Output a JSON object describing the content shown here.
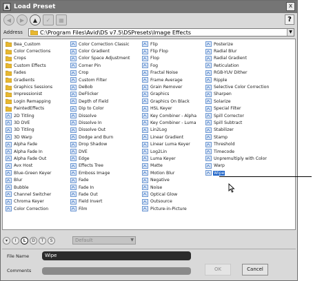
{
  "window": {
    "title": "Load Preset",
    "close_glyph": "x",
    "help_glyph": "?"
  },
  "toolbar": {
    "buttons": [
      "back-icon",
      "forward-icon",
      "up-icon",
      "checkmark-icon",
      "grid-view-icon"
    ]
  },
  "address": {
    "label": "Address",
    "path": "C:\\Program Files\\Avid\\DS  v7.5\\DSPresets\\Image Effects"
  },
  "columns": [
    [
      {
        "label": "Bea_Custom",
        "type": "folder"
      },
      {
        "label": "Color Corrections",
        "type": "folder"
      },
      {
        "label": "Crops",
        "type": "folder"
      },
      {
        "label": "Custom Effects",
        "type": "folder"
      },
      {
        "label": "Fades",
        "type": "folder"
      },
      {
        "label": "Gradients",
        "type": "folder"
      },
      {
        "label": "Graphics Sessions",
        "type": "folder"
      },
      {
        "label": "Impressionist",
        "type": "folder"
      },
      {
        "label": "Login Remapping",
        "type": "folder"
      },
      {
        "label": "PaintedEffects",
        "type": "folder"
      },
      {
        "label": "2D Titling",
        "type": "preset"
      },
      {
        "label": "3D DVE",
        "type": "preset"
      },
      {
        "label": "3D Titling",
        "type": "preset"
      },
      {
        "label": "3D Warp",
        "type": "preset"
      },
      {
        "label": "Alpha Fade",
        "type": "preset"
      },
      {
        "label": "Alpha Fade In",
        "type": "preset"
      },
      {
        "label": "Alpha Fade Out",
        "type": "preset"
      },
      {
        "label": "Avx Host",
        "type": "preset"
      },
      {
        "label": "Blue-Green Keyer",
        "type": "preset"
      },
      {
        "label": "Blur",
        "type": "preset"
      },
      {
        "label": "Bubble",
        "type": "preset"
      },
      {
        "label": "Channel Switcher",
        "type": "preset"
      },
      {
        "label": "Chroma Keyer",
        "type": "preset"
      },
      {
        "label": "Color Correction",
        "type": "preset"
      }
    ],
    [
      {
        "label": "Color Correction Classic",
        "type": "preset"
      },
      {
        "label": "Color Gradient",
        "type": "preset"
      },
      {
        "label": "Color Space Adjustment",
        "type": "preset"
      },
      {
        "label": "Corner Pin",
        "type": "preset"
      },
      {
        "label": "Crop",
        "type": "preset"
      },
      {
        "label": "Custom Filter",
        "type": "preset"
      },
      {
        "label": "DeBob",
        "type": "preset"
      },
      {
        "label": "DeFlicker",
        "type": "preset"
      },
      {
        "label": "Depth of Field",
        "type": "preset"
      },
      {
        "label": "Dip to Color",
        "type": "preset"
      },
      {
        "label": "Dissolve",
        "type": "preset"
      },
      {
        "label": "Dissolve In",
        "type": "preset"
      },
      {
        "label": "Dissolve Out",
        "type": "preset"
      },
      {
        "label": "Dodge and Burn",
        "type": "preset"
      },
      {
        "label": "Drop Shadow",
        "type": "preset"
      },
      {
        "label": "DVE",
        "type": "preset"
      },
      {
        "label": "Edge",
        "type": "preset"
      },
      {
        "label": "Effects Tree",
        "type": "preset"
      },
      {
        "label": "Emboss Image",
        "type": "preset"
      },
      {
        "label": "Fade",
        "type": "preset"
      },
      {
        "label": "Fade In",
        "type": "preset"
      },
      {
        "label": "Fade Out",
        "type": "preset"
      },
      {
        "label": "Field Invert",
        "type": "preset"
      },
      {
        "label": "Film",
        "type": "preset"
      }
    ],
    [
      {
        "label": "Flip",
        "type": "preset"
      },
      {
        "label": "Flip Flop",
        "type": "preset"
      },
      {
        "label": "Flop",
        "type": "preset"
      },
      {
        "label": "Fog",
        "type": "preset"
      },
      {
        "label": "Fractal Noise",
        "type": "preset"
      },
      {
        "label": "Frame Average",
        "type": "preset"
      },
      {
        "label": "Grain Remover",
        "type": "preset"
      },
      {
        "label": "Graphics",
        "type": "preset"
      },
      {
        "label": "Graphics On Black",
        "type": "preset"
      },
      {
        "label": "HSL Keyer",
        "type": "preset"
      },
      {
        "label": "Key Combiner - Alpha",
        "type": "preset"
      },
      {
        "label": "Key Combiner - Luma",
        "type": "preset"
      },
      {
        "label": "Lin2Log",
        "type": "preset"
      },
      {
        "label": "Linear Gradient",
        "type": "preset"
      },
      {
        "label": "Linear Luma Keyer",
        "type": "preset"
      },
      {
        "label": "Log2Lin",
        "type": "preset"
      },
      {
        "label": "Luma Keyer",
        "type": "preset"
      },
      {
        "label": "Matte",
        "type": "preset"
      },
      {
        "label": "Motion Blur",
        "type": "preset"
      },
      {
        "label": "Negative",
        "type": "preset"
      },
      {
        "label": "Noise",
        "type": "preset"
      },
      {
        "label": "Optical Glow",
        "type": "preset"
      },
      {
        "label": "Outsource",
        "type": "preset"
      },
      {
        "label": "Picture-in-Picture",
        "type": "preset"
      }
    ],
    [
      {
        "label": "Posterize",
        "type": "preset"
      },
      {
        "label": "Radial Blur",
        "type": "preset"
      },
      {
        "label": "Radial Gradient",
        "type": "preset"
      },
      {
        "label": "Reticulation",
        "type": "preset"
      },
      {
        "label": "RGB-YUV Dither",
        "type": "preset"
      },
      {
        "label": "Ripple",
        "type": "preset"
      },
      {
        "label": "Selective Color Correction",
        "type": "preset"
      },
      {
        "label": "Sharpen",
        "type": "preset"
      },
      {
        "label": "Solarize",
        "type": "preset"
      },
      {
        "label": "Special Filter",
        "type": "preset"
      },
      {
        "label": "Spill Corrector",
        "type": "preset"
      },
      {
        "label": "Spill Subtract",
        "type": "preset"
      },
      {
        "label": "Stabilizer",
        "type": "preset"
      },
      {
        "label": "Stamp",
        "type": "preset"
      },
      {
        "label": "Threshold",
        "type": "preset"
      },
      {
        "label": "Timecode",
        "type": "preset"
      },
      {
        "label": "Unpremultiply with Color",
        "type": "preset"
      },
      {
        "label": "Warp",
        "type": "preset"
      },
      {
        "label": "Wipe",
        "type": "preset",
        "selected": true
      }
    ]
  ],
  "view_buttons": [
    {
      "label": "▾",
      "on": false
    },
    {
      "label": "I",
      "on": false
    },
    {
      "label": "L",
      "on": true
    },
    {
      "label": "D",
      "on": false
    },
    {
      "label": "T",
      "on": false
    },
    {
      "label": "S",
      "on": false
    }
  ],
  "view_select": {
    "value": "Default"
  },
  "file_name": {
    "label": "File Name",
    "value": "Wipe"
  },
  "comments": {
    "label": "Comments",
    "value": ""
  },
  "buttons": {
    "ok": "OK",
    "cancel": "Cancel"
  },
  "colors": {
    "titlebar": "#757575",
    "selection": "#1e64c8",
    "folder": "#e8b830",
    "preset_icon": "#4a7fc8",
    "field_dark": "#2b2b2b"
  }
}
